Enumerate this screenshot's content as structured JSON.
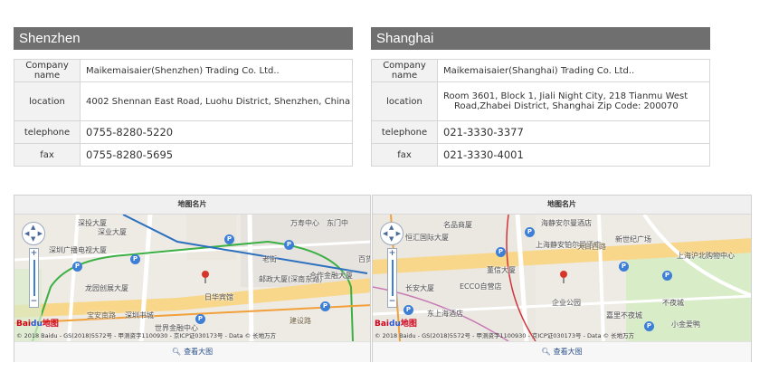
{
  "offices": [
    {
      "city": "Shenzhen",
      "company_label": "Company name",
      "company": "Maikemaisaier(Shenzhen) Trading Co. Ltd..",
      "location_label": "location",
      "location_line1": "4002 Shennan East Road, Luohu District, Shenzhen, China",
      "telephone_label": "telephone",
      "telephone": "0755-8280-5220",
      "fax_label": "fax",
      "fax": "0755-8280-5695"
    },
    {
      "city": "Shanghai",
      "company_label": "Company name",
      "company": "Maikemaisaier(Shanghai) Trading Co. Ltd..",
      "location_label": "location",
      "location_line1": "Room 3601, Block 1, Jiali Night City, 218 Tianmu West",
      "location_line2": "Road,Zhabei District, Shanghai Zip Code: 200070",
      "telephone_label": "telephone",
      "telephone": "021-3330-3377",
      "fax_label": "fax",
      "fax": "021-3330-4001"
    }
  ],
  "maps": [
    {
      "title": "地图名片",
      "view_large": "查看大图",
      "copyright": "© 2018 Baidu - GS(2018)5572号 - 甲测资字1100930 - 京ICP证030173号 - Data © 长地万方",
      "logo_text": "Bai",
      "logo_paw": "du",
      "logo_suffix": "地图",
      "labels": {
        "l0": "深投大厦",
        "l1": "深业大厦",
        "l2": "深圳广播电视大厦",
        "l3": "老街",
        "l4": "邮政大厦(深南东路)",
        "l5": "合作金融大厦",
        "l6": "日华宾馆",
        "l7": "龙园创展大厦",
        "l8": "宝安南路",
        "l9": "深圳书城",
        "l10": "世界金融中心",
        "l11": "建设路",
        "l12": "东门中",
        "l13": "万寿中心",
        "l14": "百货"
      }
    },
    {
      "title": "地图名片",
      "view_large": "查看大图",
      "copyright": "© 2018 Baidu - GS(2018)5572号 - 甲测资字1100930 - 京ICP证030173号 - Data © 长地万方",
      "logo_text": "Bai",
      "logo_paw": "du",
      "logo_suffix": "地图",
      "labels": {
        "l0": "名品商厦",
        "l1": "恒汇国际大厦",
        "l2": "海静安尔曼酒店",
        "l3": "上海静安铂尔曼酒店",
        "l4": "新世纪广场",
        "l5": "天目西路",
        "l6": "上海沪北购物中心",
        "l7": "长安大厦",
        "l8": "ECCO自营店",
        "l9": "不夜城",
        "l10": "企业公园",
        "l11": "嘉里不夜城",
        "l12": "小金爱鸭",
        "l13": "董信大厦",
        "l14": "东上海酒店"
      }
    }
  ]
}
